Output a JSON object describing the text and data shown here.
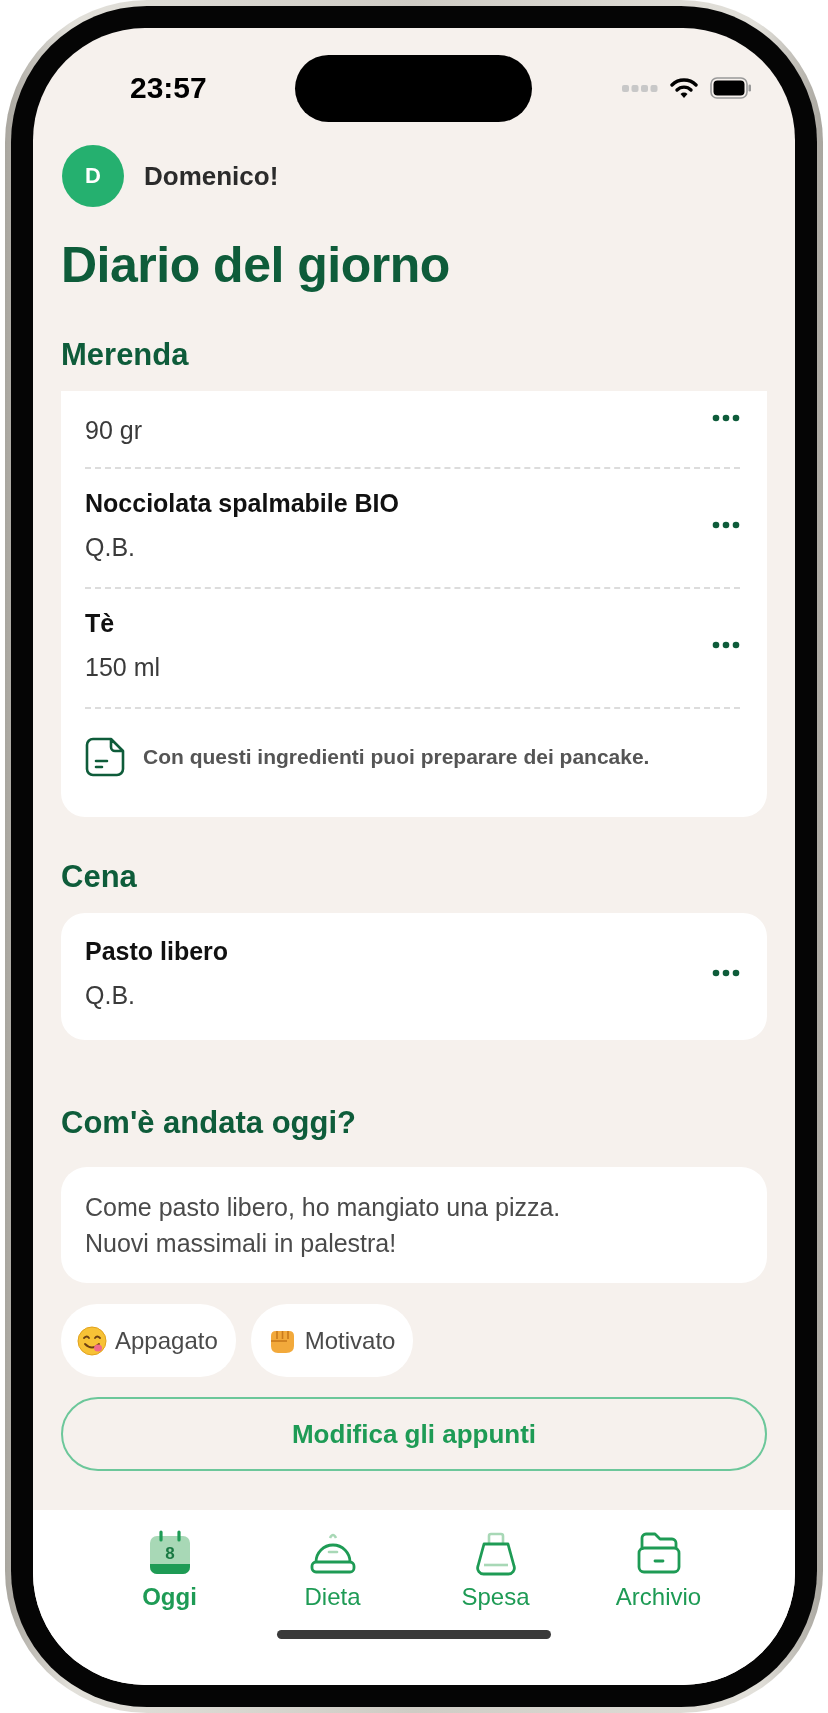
{
  "status_bar": {
    "time": "23:57"
  },
  "header": {
    "avatar_initial": "D",
    "greeting": "Domenico!"
  },
  "title": "Diario del giorno",
  "meals": [
    {
      "name": "Merenda",
      "cut_off_top": true,
      "items": [
        {
          "quantity": "90 gr"
        },
        {
          "name": "Nocciolata spalmabile BIO",
          "quantity": "Q.B."
        },
        {
          "name": "Tè",
          "quantity": "150 ml"
        }
      ],
      "note": "Con questi ingredienti puoi preparare dei pancake."
    },
    {
      "name": "Cena",
      "cut_off_top": false,
      "items": [
        {
          "name": "Pasto libero",
          "quantity": "Q.B."
        }
      ]
    }
  ],
  "notes": {
    "heading": "Com'è andata oggi?",
    "lines": [
      "Come pasto libero, ho mangiato una pizza.",
      "Nuovi massimali in palestra!"
    ]
  },
  "moods": [
    {
      "kind": "yum",
      "label": "Appagato"
    },
    {
      "kind": "fist",
      "label": "Motivato"
    }
  ],
  "edit_button": "Modifica gli appunti",
  "tab_bar": [
    {
      "kind": "calendar",
      "label": "Oggi",
      "day": "8",
      "selected": true
    },
    {
      "kind": "cloche",
      "label": "Dieta",
      "selected": false
    },
    {
      "kind": "bag",
      "label": "Spesa",
      "selected": false
    },
    {
      "kind": "folder",
      "label": "Archivio",
      "selected": false
    }
  ]
}
